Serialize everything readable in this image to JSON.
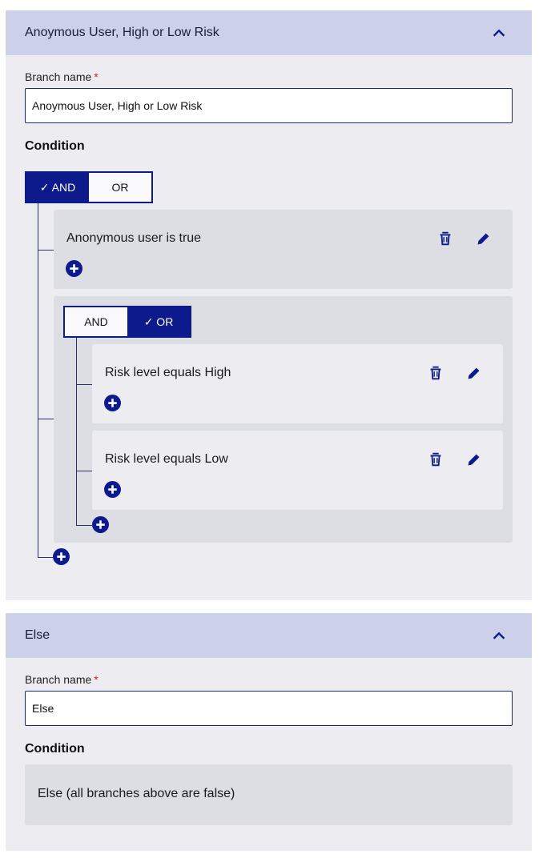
{
  "branches": [
    {
      "title": "Anoymous User, High or Low Risk",
      "branch_name_label": "Branch name",
      "branch_name_value": "Anoymous User, High or Low Risk",
      "condition_label": "Condition",
      "toggle": {
        "and_label": "✓ AND",
        "or_label": "OR",
        "selected": "AND"
      },
      "conditions": [
        {
          "text": "Anonymous user is true"
        }
      ],
      "group": {
        "toggle": {
          "and_label": "AND",
          "or_label": "✓ OR",
          "selected": "OR"
        },
        "conditions": [
          {
            "text": "Risk level equals High"
          },
          {
            "text": "Risk level equals Low"
          }
        ]
      }
    },
    {
      "title": "Else",
      "branch_name_label": "Branch name",
      "branch_name_value": "Else",
      "condition_label": "Condition",
      "else_text": "Else (all branches above are false)"
    }
  ],
  "required_marker": "*",
  "icons": {
    "collapse": "chevron-up-icon",
    "delete": "trash-icon",
    "edit": "pencil-icon",
    "add": "add-circle-icon"
  },
  "colors": {
    "accent": "#0c1a8c",
    "header_bg": "#ccd0e9",
    "panel_bg": "#ececf1",
    "card_bg": "#dddde4",
    "required": "#d32121"
  }
}
